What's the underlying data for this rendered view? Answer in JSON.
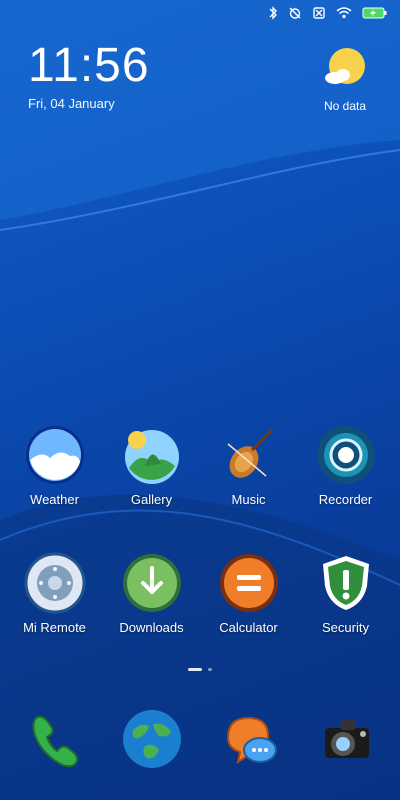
{
  "status_bar": {
    "icons": [
      "bluetooth-icon",
      "alarm-off-icon",
      "no-sim-icon",
      "wifi-icon",
      "battery-charging-icon"
    ]
  },
  "lockscreen": {
    "time": "11:56",
    "date": "Fri, 04 January",
    "weather_status": "No data"
  },
  "home": {
    "row1": [
      {
        "label": "Weather"
      },
      {
        "label": "Gallery"
      },
      {
        "label": "Music"
      },
      {
        "label": "Recorder"
      }
    ],
    "row2": [
      {
        "label": "Mi Remote"
      },
      {
        "label": "Downloads"
      },
      {
        "label": "Calculator"
      },
      {
        "label": "Security"
      }
    ],
    "page_indicator": {
      "pages": 2,
      "current": 1
    }
  },
  "dock": {
    "apps": [
      "phone-icon",
      "browser-globe-icon",
      "messages-icon",
      "camera-icon"
    ]
  }
}
